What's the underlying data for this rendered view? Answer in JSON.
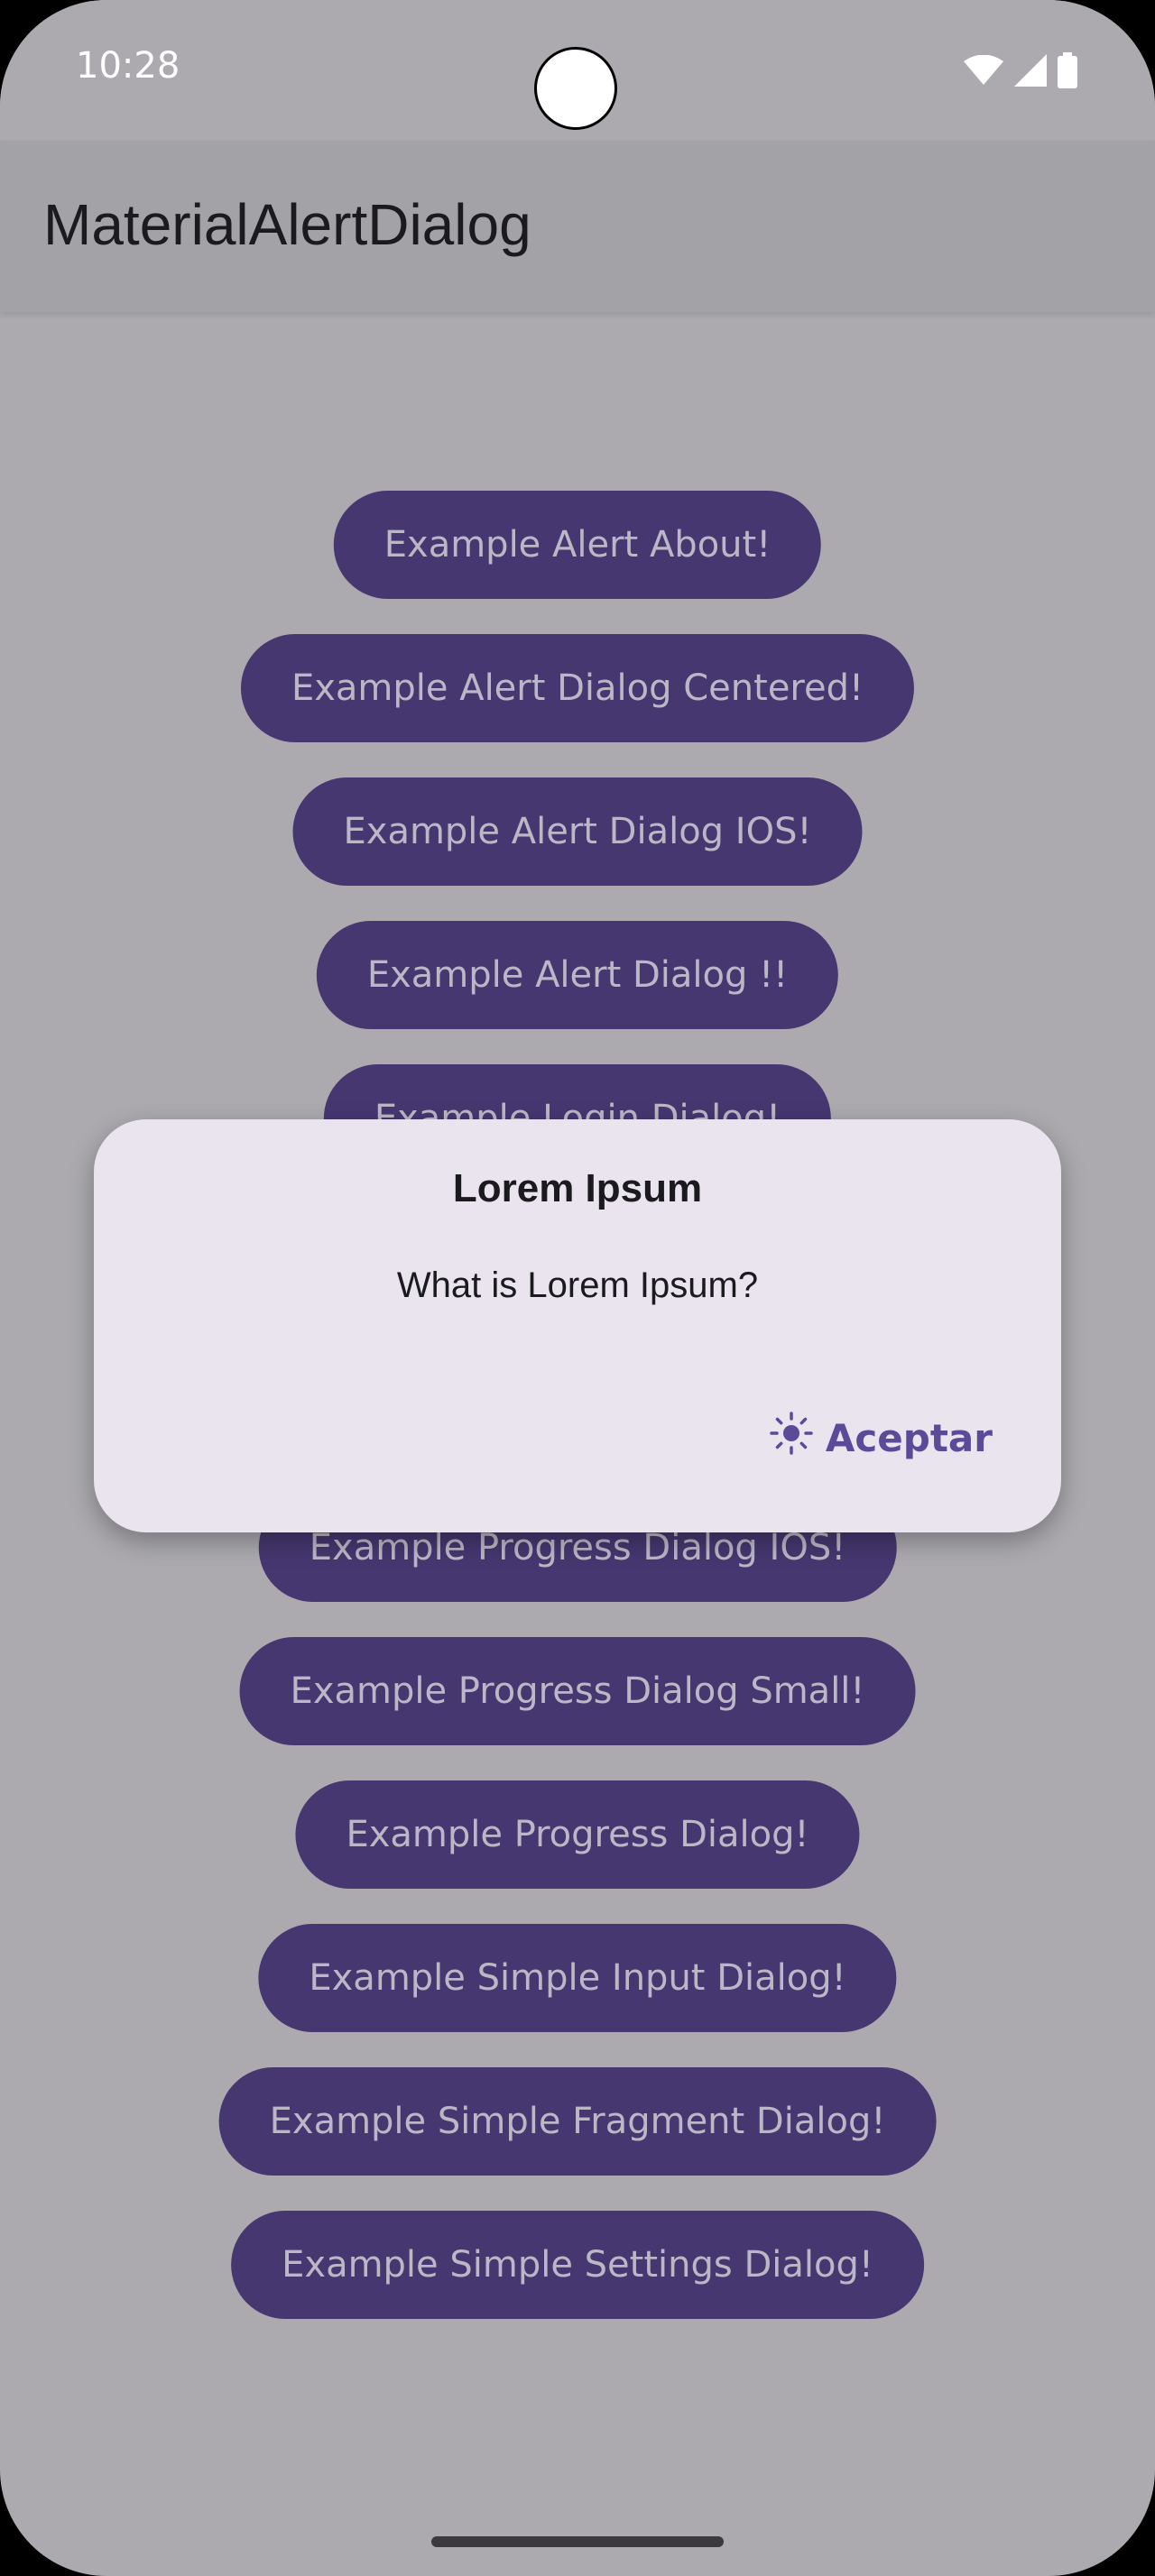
{
  "status_bar": {
    "time": "10:28",
    "icons": [
      "wifi-icon",
      "cellular-signal-icon",
      "battery-icon"
    ]
  },
  "app_bar": {
    "title": "MaterialAlertDialog"
  },
  "buttons": [
    "Example Alert About!",
    "Example Alert Dialog Centered!",
    "Example Alert Dialog IOS!",
    "Example Alert Dialog !!",
    "Example Login Dialog!",
    "Example Progress Dialog IOS!",
    "Example Progress Dialog Small!",
    "Example Progress Dialog!",
    "Example Simple Input Dialog!",
    "Example Simple Fragment Dialog!",
    "Example Simple Settings Dialog!"
  ],
  "dialog": {
    "title": "Lorem Ipsum",
    "message": "What is Lorem Ipsum?",
    "action_label": "Aceptar",
    "action_icon": "sun-icon"
  },
  "colors": {
    "screen_background": "#acaaaf",
    "app_bar_background": "#a3a2a7",
    "button_background": "#463770",
    "button_text": "#bcb7c6",
    "dialog_background": "#e9e4ee",
    "accent": "#5b4a98"
  }
}
